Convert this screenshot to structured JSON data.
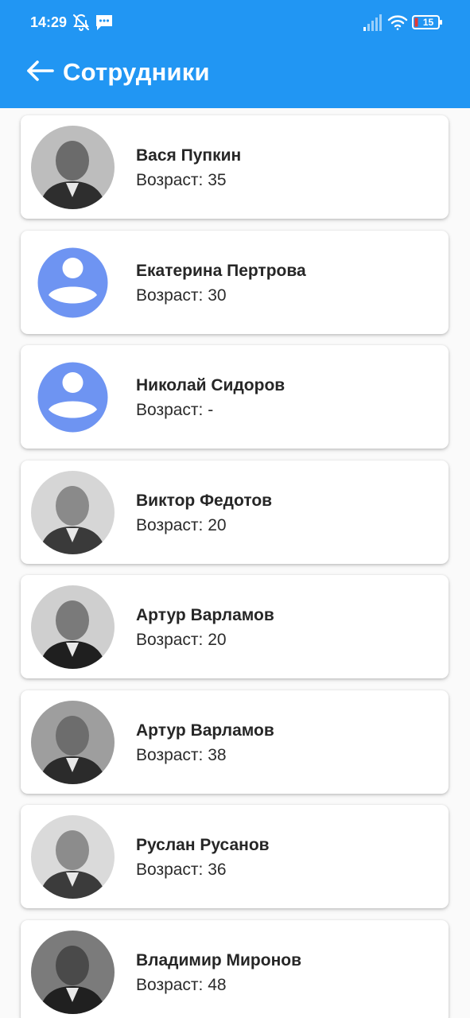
{
  "status_bar": {
    "time": "14:29",
    "battery_level": "15",
    "icons": [
      "alarm-off-icon",
      "message-icon",
      "signal-icon",
      "wifi-icon",
      "battery-icon"
    ]
  },
  "header": {
    "title": "Сотрудники",
    "back_icon": "arrow-left-icon",
    "background_color": "#2196f3"
  },
  "employees": [
    {
      "name": "Вася Пупкин",
      "age": "Возраст: 35",
      "avatar": "photo"
    },
    {
      "name": "Екатерина Пертрова",
      "age": "Возраст: 30",
      "avatar": "placeholder"
    },
    {
      "name": "Николай Сидоров",
      "age": "Возраст: -",
      "avatar": "placeholder"
    },
    {
      "name": "Виктор Федотов",
      "age": "Возраст: 20",
      "avatar": "photo"
    },
    {
      "name": "Артур Варламов",
      "age": "Возраст: 20",
      "avatar": "photo"
    },
    {
      "name": "Артур Варламов",
      "age": "Возраст: 38",
      "avatar": "photo"
    },
    {
      "name": "Руслан Русанов",
      "age": "Возраст: 36",
      "avatar": "photo"
    },
    {
      "name": "Владимир Миронов",
      "age": "Возраст: 48",
      "avatar": "photo"
    }
  ],
  "colors": {
    "placeholder_avatar": "#6e94f2",
    "card_background": "#ffffff",
    "page_background": "#fafafa"
  }
}
